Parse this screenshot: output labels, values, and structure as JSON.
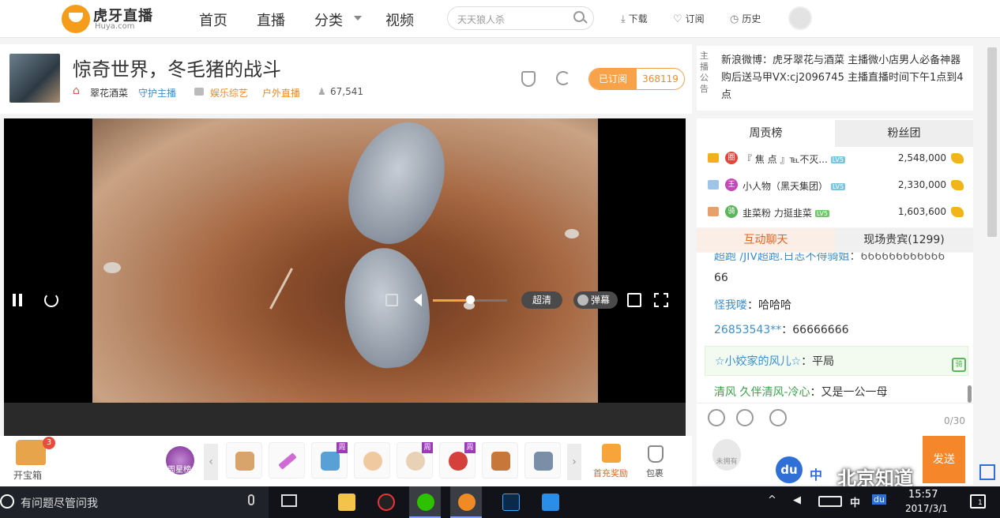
{
  "nav": {
    "logo_main": "虎牙直播",
    "logo_sub": "Huya.com",
    "items": [
      "首页",
      "直播",
      "分类",
      "视频"
    ],
    "search_placeholder": "天天狼人杀",
    "download": "下载",
    "subscriptions": "订阅",
    "history": "历史"
  },
  "room": {
    "title": "惊奇世界，冬毛猪的战斗",
    "anchor": "翠花酒菜",
    "guard": "守护主播",
    "category": "娱乐综艺",
    "subcategory": "户外直播",
    "viewers": "67,541",
    "subscribe_label": "已订阅",
    "subscriber_count": "368119"
  },
  "notice": {
    "label": "主播公告",
    "text": "新浪微博：虎牙翠花与酒菜 主播微小店男人必备神器购后送马甲VX:cj2096745 主播直播时间下午1点到4点"
  },
  "player": {
    "quality": "超清",
    "danmu": "弹幕",
    "volume_fraction": 0.5
  },
  "gifts": {
    "chest_label": "开宝箱",
    "chest_badge": "3",
    "week_star": "周星榜",
    "recharge": "首充奖励",
    "bag": "包裹",
    "week_tag": "周",
    "prev": "‹",
    "next": "›"
  },
  "rank": {
    "tabs": [
      "周贡榜",
      "粉丝团"
    ],
    "level_badge": "LV5",
    "rows": [
      {
        "badge": "圈",
        "name": "『 焦 点 』℡不灭...",
        "value": "2,548,000"
      },
      {
        "badge": "王",
        "name": "小人物（黑天集团）",
        "value": "2,330,000"
      },
      {
        "badge": "骑",
        "name": "韭菜粉 力挺韭菜",
        "value": "1,603,600"
      }
    ]
  },
  "chat": {
    "tabs": [
      "互动聊天",
      "现场贵宾(1299)"
    ],
    "messages": [
      {
        "nick": "超跑 /JIV超跑.日志不得骑姐",
        "text": "：666666666666"
      },
      {
        "nick": "",
        "text": "66"
      },
      {
        "nick": "怪我喽",
        "text": "：哈哈哈"
      },
      {
        "nick": "26853543**",
        "text": "：66666666"
      },
      {
        "nick": "☆小姣家的风儿☆",
        "text": "：平局"
      },
      {
        "nick": "清风 久伴清风-冷心",
        "text": "：又是一公一母"
      }
    ],
    "highlight_tag": "骑",
    "count": "0/30",
    "send": "发送",
    "novip": "未拥有",
    "input_value": "",
    "ime_du": "du",
    "ime_cn": "中"
  },
  "watermark": "北京知道",
  "taskbar": {
    "search": "有问题尽管问我",
    "tray_ime": "中",
    "tray_du": "du",
    "time": "15:57",
    "date": "2017/3/1",
    "notifications": "1"
  }
}
